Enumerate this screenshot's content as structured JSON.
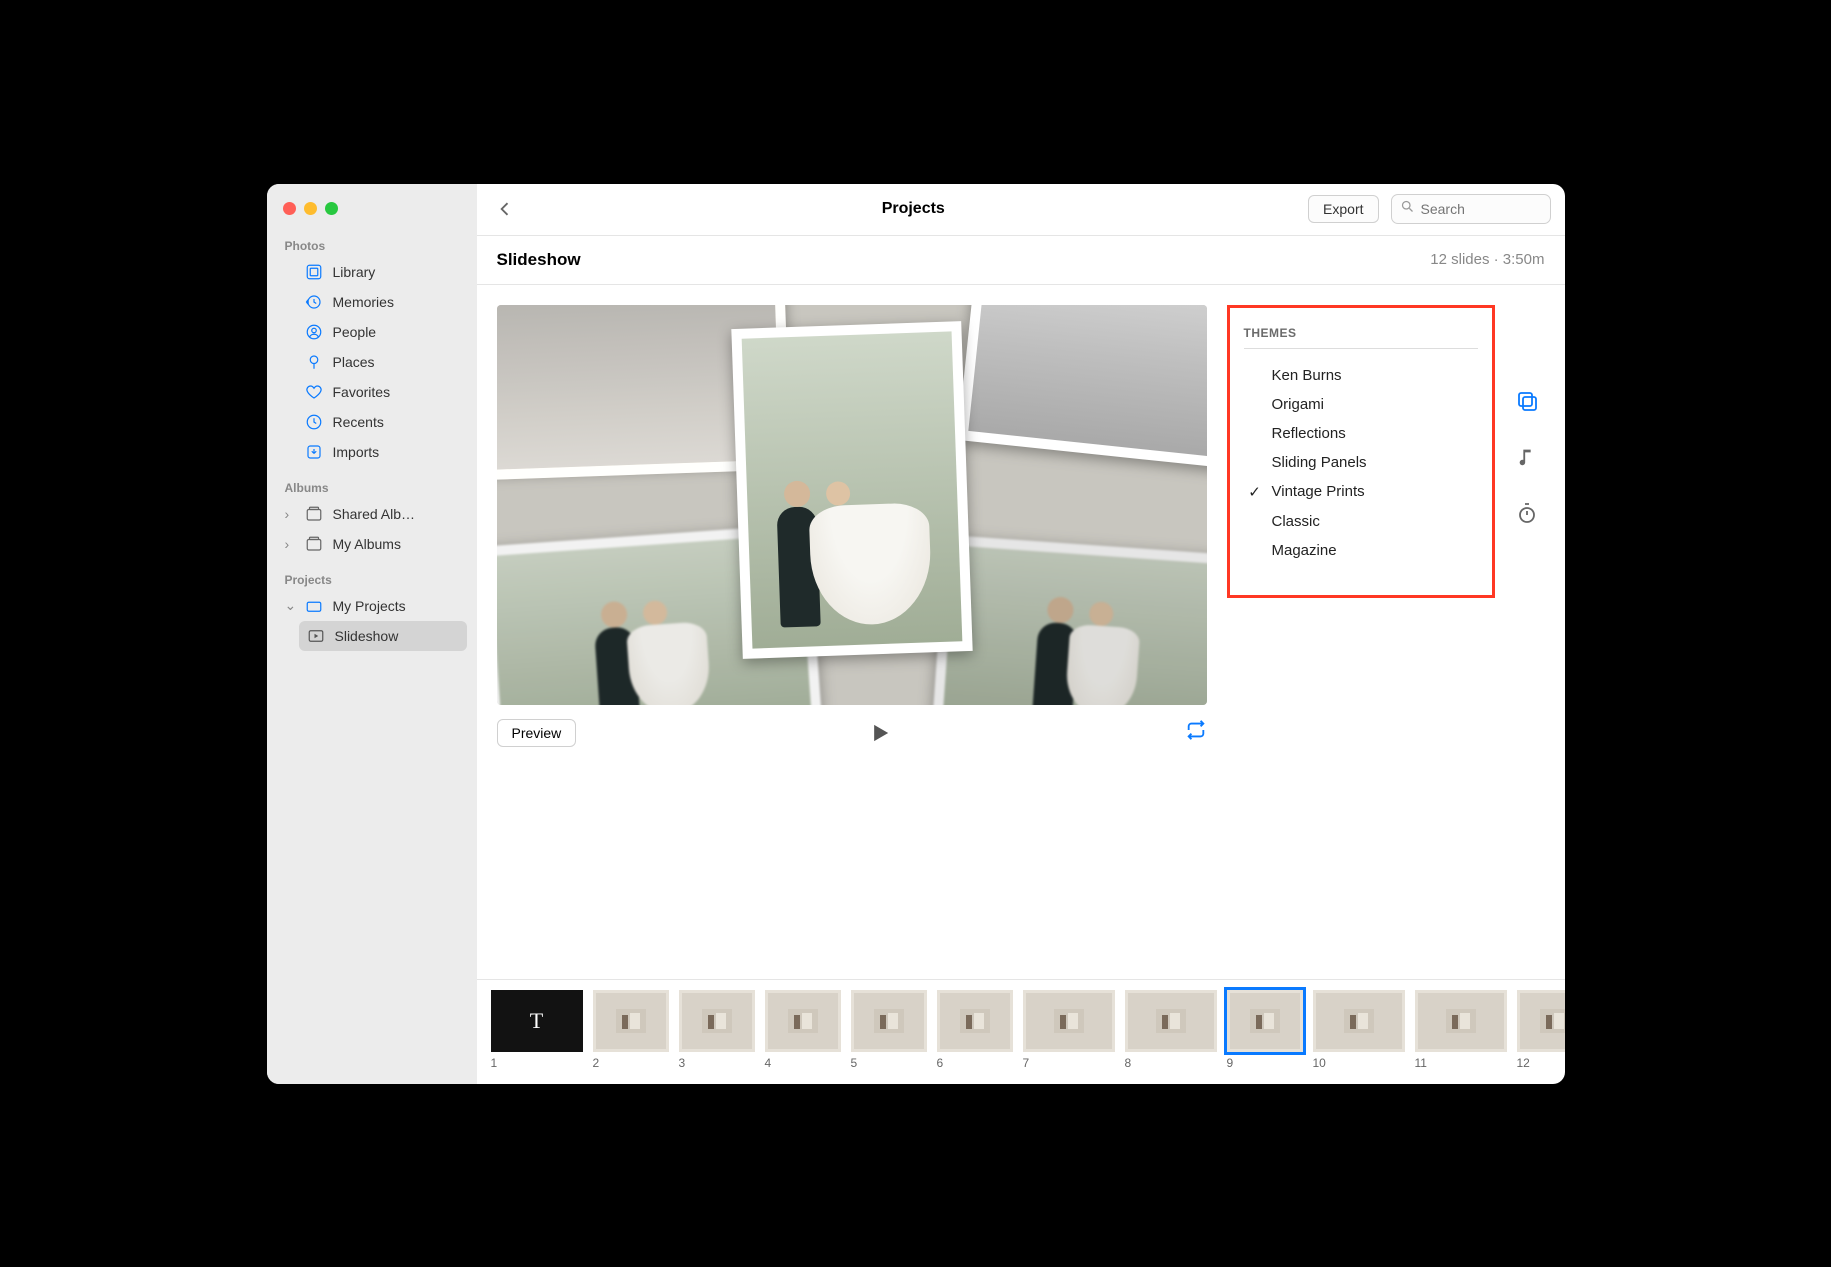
{
  "titlebar": {
    "title": "Projects",
    "export": "Export",
    "search_placeholder": "Search"
  },
  "subheader": {
    "title": "Slideshow",
    "meta": "12 slides · 3:50m"
  },
  "sidebar": {
    "photos_head": "Photos",
    "photos": [
      {
        "label": "Library",
        "icon": "grid"
      },
      {
        "label": "Memories",
        "icon": "clock-arrow"
      },
      {
        "label": "People",
        "icon": "person"
      },
      {
        "label": "Places",
        "icon": "pin"
      },
      {
        "label": "Favorites",
        "icon": "heart"
      },
      {
        "label": "Recents",
        "icon": "clock"
      },
      {
        "label": "Imports",
        "icon": "import"
      }
    ],
    "albums_head": "Albums",
    "albums": [
      {
        "label": "Shared Alb…",
        "expand": true
      },
      {
        "label": "My Albums",
        "expand": true
      }
    ],
    "projects_head": "Projects",
    "my_projects": "My Projects",
    "slideshow": "Slideshow"
  },
  "controls": {
    "preview": "Preview"
  },
  "themes": {
    "heading": "THEMES",
    "items": [
      {
        "label": "Ken Burns",
        "selected": false
      },
      {
        "label": "Origami",
        "selected": false
      },
      {
        "label": "Reflections",
        "selected": false
      },
      {
        "label": "Sliding Panels",
        "selected": false
      },
      {
        "label": "Vintage Prints",
        "selected": true
      },
      {
        "label": "Classic",
        "selected": false
      },
      {
        "label": "Magazine",
        "selected": false
      }
    ]
  },
  "thumbs": [
    {
      "label": "1",
      "title": true,
      "wide": true
    },
    {
      "label": "2"
    },
    {
      "label": "3"
    },
    {
      "label": "4"
    },
    {
      "label": "5"
    },
    {
      "label": "6"
    },
    {
      "label": "7",
      "wide": true
    },
    {
      "label": "8",
      "wide": true
    },
    {
      "label": "9",
      "selected": true
    },
    {
      "label": "10",
      "wide": true
    },
    {
      "label": "11",
      "wide": true
    },
    {
      "label": "12"
    }
  ]
}
